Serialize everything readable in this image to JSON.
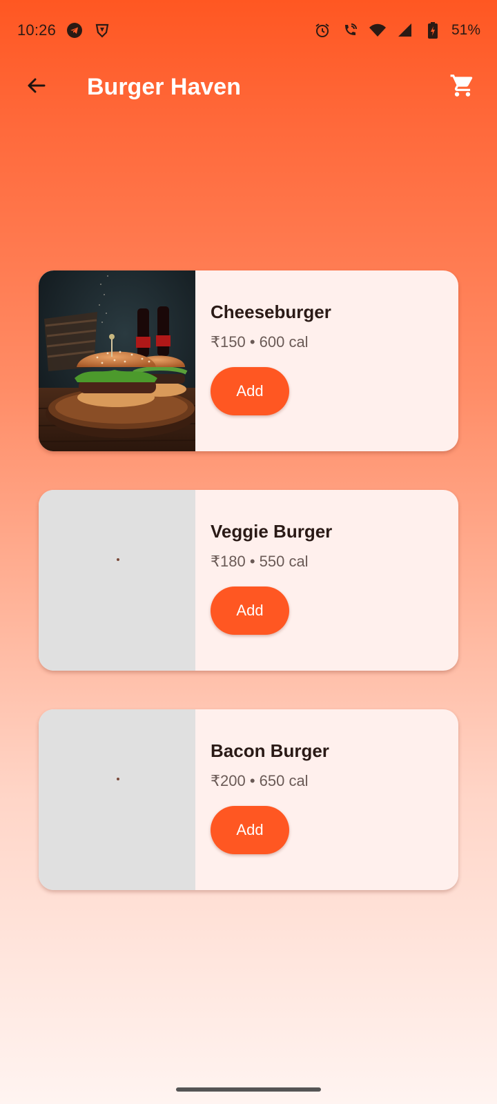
{
  "status_bar": {
    "time": "10:26",
    "left_icons": [
      "telegram-icon",
      "vpn-shield-icon"
    ],
    "right_icons": [
      "alarm-icon",
      "wifi-call-icon",
      "wifi-icon",
      "signal-icon",
      "battery-charging-icon"
    ],
    "battery": "51%"
  },
  "app_bar": {
    "title": "Burger Haven",
    "back_icon": "arrow-back-icon",
    "cart_icon": "shopping-cart-icon"
  },
  "theme": {
    "accent": "#ff5722",
    "card_background": "#fff0ed",
    "placeholder": "#e0e0e0"
  },
  "menu": [
    {
      "name": "Cheeseburger",
      "meta": "₹150 • 600 cal",
      "add_label": "Add",
      "image": "burger-photo"
    },
    {
      "name": "Veggie Burger",
      "meta": "₹180 • 550 cal",
      "add_label": "Add",
      "image": "loading-placeholder"
    },
    {
      "name": "Bacon Burger",
      "meta": "₹200 • 650 cal",
      "add_label": "Add",
      "image": "loading-placeholder"
    }
  ]
}
